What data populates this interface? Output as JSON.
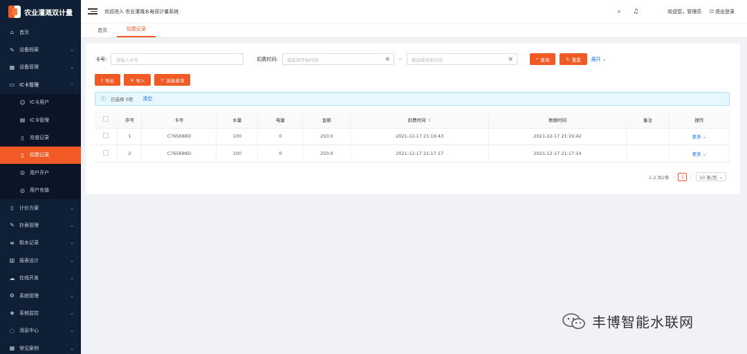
{
  "app": {
    "title": "农业灌溉双计量"
  },
  "header": {
    "welcome": "欢迎进入 农业灌溉水电双计量系统",
    "user_text": "欢迎您，管理员",
    "logout_label": "退出登录"
  },
  "sidebar": {
    "items": [
      {
        "label": "首页",
        "icon": "home-icon"
      },
      {
        "label": "设备档案",
        "icon": "wrench-icon",
        "has_arrow": true
      },
      {
        "label": "设备管理",
        "icon": "device-icon",
        "has_arrow": true
      },
      {
        "label": "IC卡管理",
        "icon": "card-icon",
        "has_arrow": true,
        "expanded": true
      }
    ],
    "sub_items": [
      {
        "label": "IC卡用户",
        "icon": "users-icon"
      },
      {
        "label": "IC卡管理",
        "icon": "idcard-icon"
      },
      {
        "label": "充值记录",
        "icon": "doc-icon"
      },
      {
        "label": "扣费记录",
        "icon": "doc-icon",
        "active": true
      },
      {
        "label": "用户开户",
        "icon": "circle-icon"
      },
      {
        "label": "用户充值",
        "icon": "circle-icon"
      }
    ],
    "items_after": [
      {
        "label": "计价方案",
        "icon": "doc-icon"
      },
      {
        "label": "抄表管理",
        "icon": "edit-icon"
      },
      {
        "label": "取水记录",
        "icon": "list-icon"
      },
      {
        "label": "报表设计",
        "icon": "chart-icon"
      },
      {
        "label": "在线开发",
        "icon": "cloud-icon"
      },
      {
        "label": "系统管理",
        "icon": "gear-icon"
      },
      {
        "label": "系统监控",
        "icon": "monitor-icon"
      },
      {
        "label": "消息中心",
        "icon": "message-icon"
      },
      {
        "label": "常见案例",
        "icon": "grid-icon"
      }
    ]
  },
  "tabs": [
    {
      "label": "首页"
    },
    {
      "label": "扣费记录",
      "active": true
    }
  ],
  "filter": {
    "card_label": "卡号:",
    "card_placeholder": "请输入卡号",
    "time_label": "扣费时间:",
    "start_placeholder": "请选择开始时间",
    "range_sep": "~",
    "end_placeholder": "请选择结束时间",
    "search_label": "查询",
    "reset_label": "重置",
    "expand_label": "展开"
  },
  "actions": {
    "export_label": "导出",
    "import_label": "导入",
    "advanced_label": "高级查询"
  },
  "selection": {
    "text": "已选择 0项",
    "clear_label": "清空"
  },
  "table": {
    "columns": [
      "序号",
      "卡号",
      "水量",
      "电量",
      "金额",
      "扣费时间",
      "数据时间",
      "备注",
      "操作"
    ],
    "rows": [
      {
        "no": "1",
        "card": "C765688D",
        "water": "100",
        "power": "0",
        "amount": "250.0",
        "deduct_time": "2021-12-17 21:19:43",
        "data_time": "2021-12-17 21:19:42",
        "note": "",
        "op": "更多"
      },
      {
        "no": "2",
        "card": "C765688D",
        "water": "100",
        "power": "0",
        "amount": "250.0",
        "deduct_time": "2021-12-17 21:17:17",
        "data_time": "2021-12-17 21:17:14",
        "note": "",
        "op": "更多"
      }
    ]
  },
  "pager": {
    "summary": "1-2 共2条",
    "current": "1",
    "page_size": "10 条/页"
  },
  "watermark": {
    "text": "丰博智能水联网"
  },
  "colors": {
    "accent": "#f15a24",
    "sidebar_bg": "#0f1f35",
    "link": "#1a73e8"
  }
}
